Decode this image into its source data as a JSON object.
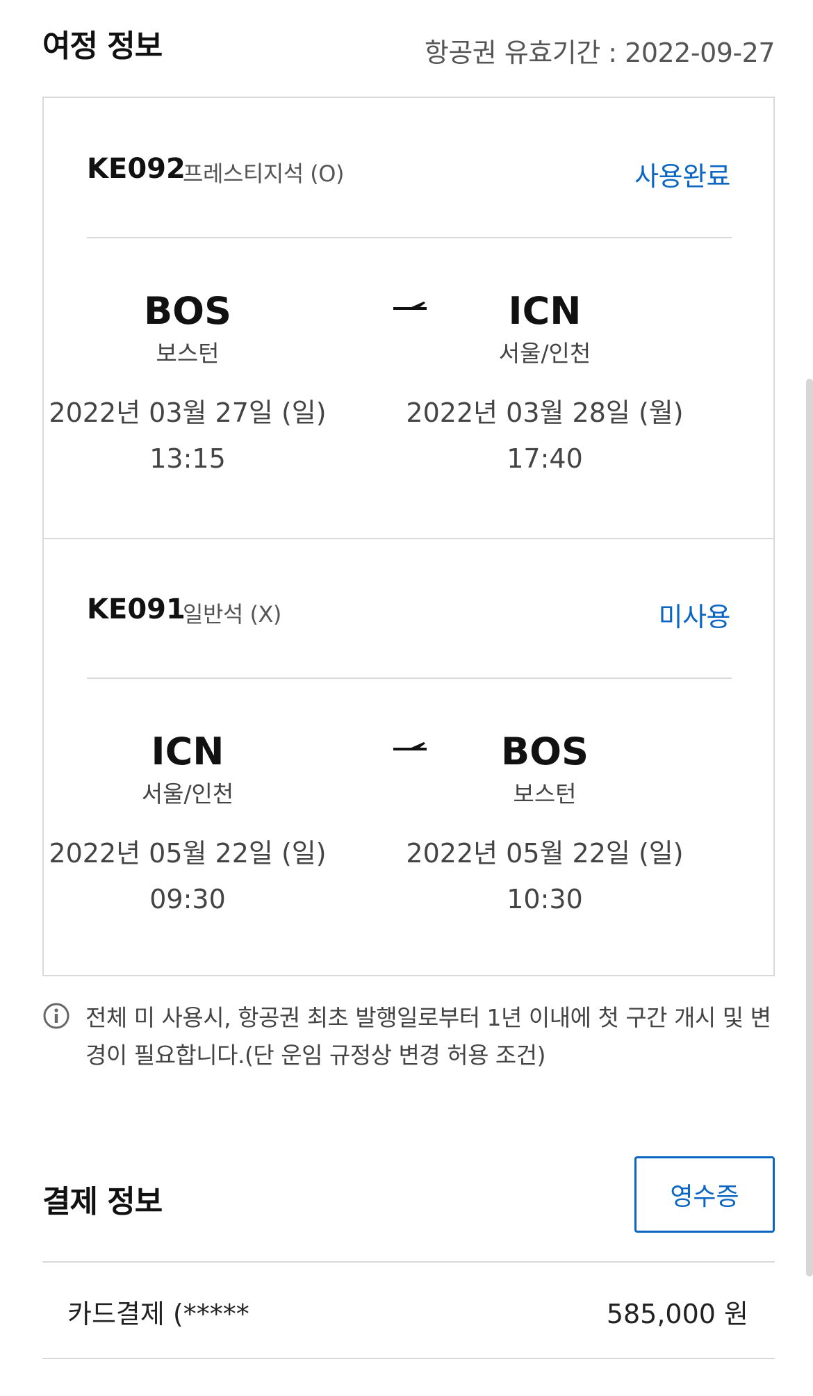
{
  "itinerary": {
    "title": "여정 정보",
    "validity": "항공권 유효기간 : 2022-09-27",
    "segments": [
      {
        "flight_no": "KE092",
        "cabin": "프레스티지석 (O)",
        "status": "사용완료",
        "origin": {
          "code": "BOS",
          "city": "보스턴",
          "date": "2022년 03월 27일 (일)",
          "time": "13:15"
        },
        "destination": {
          "code": "ICN",
          "city": "서울/인천",
          "date": "2022년 03월 28일 (월)",
          "time": "17:40"
        }
      },
      {
        "flight_no": "KE091",
        "cabin": "일반석 (X)",
        "status": "미사용",
        "origin": {
          "code": "ICN",
          "city": "서울/인천",
          "date": "2022년 05월 22일 (일)",
          "time": "09:30"
        },
        "destination": {
          "code": "BOS",
          "city": "보스턴",
          "date": "2022년 05월 22일 (일)",
          "time": "10:30"
        }
      }
    ],
    "notice": "전체 미 사용시, 항공권 최초 발행일로부터 1년 이내에 첫 구간 개시 및 변경이 필요합니다.(단 운임 규정상 변경 허용 조건)"
  },
  "payment": {
    "title": "결제 정보",
    "receipt_label": "영수증",
    "method": "카드결제 (*****",
    "amount": "585,000 원"
  },
  "colors": {
    "accent": "#0b66c3",
    "border": "#d9d9d9",
    "text_secondary": "#444444"
  },
  "icons": {
    "arrow": "plane-arrow-icon",
    "info": "info-icon"
  }
}
